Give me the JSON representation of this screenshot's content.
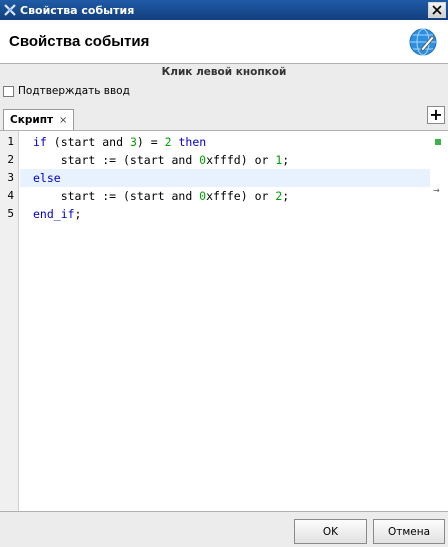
{
  "window": {
    "title": "Свойства события",
    "close_glyph": "✕"
  },
  "header": {
    "heading": "Свойства события",
    "icon": "globe-pencil-icon"
  },
  "event": {
    "label": "Клик левой кнопкой"
  },
  "confirm": {
    "label": "Подтверждать ввод",
    "checked": false
  },
  "tabs": [
    {
      "label": "Скрипт",
      "close": "×",
      "active": true
    }
  ],
  "add_tab": {
    "glyph": "+"
  },
  "editor": {
    "line_numbers": [
      "1",
      "2",
      "3",
      "4",
      "5"
    ],
    "current_line": 3,
    "lines": [
      "if (start and 3) = 2 then",
      "    start := (start and 0xfffd) or 1;",
      "else",
      "    start := (start and 0xfffe) or 2;",
      "end_if;"
    ]
  },
  "footer": {
    "ok_label": "OK",
    "cancel_label": "Отмена"
  },
  "colors": {
    "keyword": "#0000cc",
    "number": "#00a000",
    "titlebar": "#1f5ba6",
    "current_line": "#e8f2fe"
  }
}
